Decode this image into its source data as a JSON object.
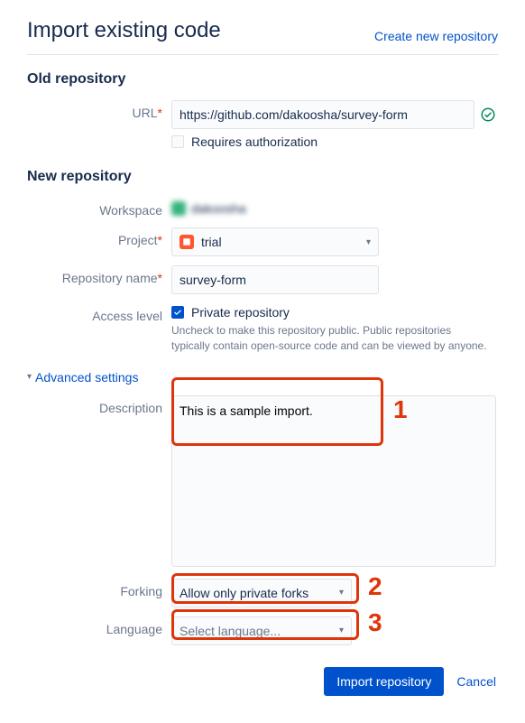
{
  "header": {
    "title": "Import existing code",
    "create_link": "Create new repository"
  },
  "old_repo": {
    "section_title": "Old repository",
    "url_label": "URL",
    "url_value": "https://github.com/dakoosha/survey-form",
    "requires_auth_label": "Requires authorization"
  },
  "new_repo": {
    "section_title": "New repository",
    "workspace_label": "Workspace",
    "workspace_value": "dakoosha",
    "project_label": "Project",
    "project_value": "trial",
    "repo_name_label": "Repository name",
    "repo_name_value": "survey-form",
    "access_label": "Access level",
    "private_label": "Private repository",
    "private_help": "Uncheck to make this repository public. Public repositories typically contain open-source code and can be viewed by anyone."
  },
  "advanced": {
    "toggle_label": "Advanced settings",
    "description_label": "Description",
    "description_value": "This is a sample import.",
    "forking_label": "Forking",
    "forking_value": "Allow only private forks",
    "language_label": "Language",
    "language_placeholder": "Select language..."
  },
  "footer": {
    "import_label": "Import repository",
    "cancel_label": "Cancel"
  },
  "callouts": {
    "one": "1",
    "two": "2",
    "three": "3"
  }
}
